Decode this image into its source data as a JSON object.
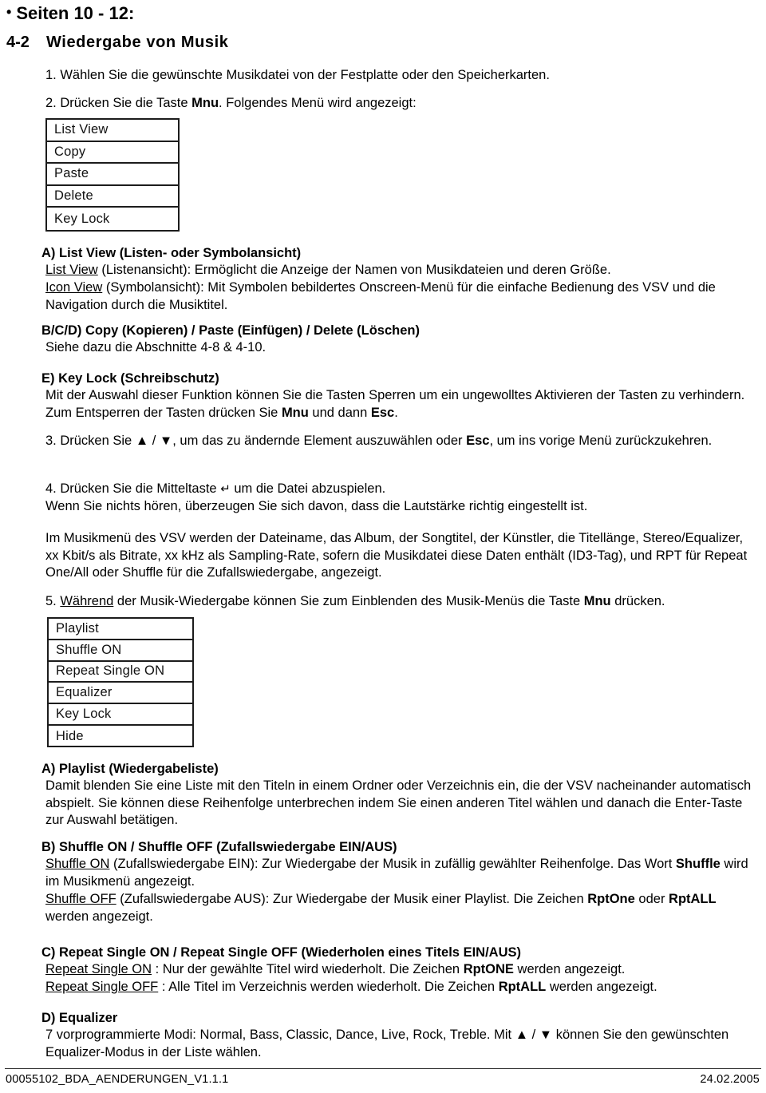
{
  "document": {
    "bullet_glyph": "•",
    "page_ref": "Seiten 10 - 12:",
    "section_number": "4-2",
    "section_title": "Wiedergabe von Musik"
  },
  "steps": {
    "step1": "1. Wählen Sie die gewünschte Musikdatei von der Festplatte oder den Speicherkarten.",
    "step2_a": "2. Drücken Sie die Taste ",
    "step2_key": "Mnu",
    "step2_b": ". Folgendes Menü wird angezeigt:",
    "step3_a": "3. Drücken Sie ",
    "step3_up": "▲",
    "step3_sep": " / ",
    "step3_down": "▼",
    "step3_b": ", um das zu ändernde Element auszuwählen oder ",
    "step3_key": "Esc",
    "step3_c": ", um ins vorige Menü zurückzukehren.",
    "step4_a": "4. Drücken Sie die Mitteltaste ",
    "step4_enter_glyph": "↵",
    "step4_b": "  um die Datei abzuspielen.",
    "step4_line2": "Wenn Sie nichts hören, überzeugen Sie sich davon, dass die Lautstärke richtig eingestellt ist.",
    "paragraph_id3": "Im Musikmenü des VSV werden der Dateiname, das Album, der Songtitel, der Künstler, die Titellänge, Stereo/Equalizer, xx Kbit/s als Bitrate, xx kHz als Sampling-Rate, sofern die Musikdatei diese Daten enthält (ID3-Tag), und RPT für Repeat One/All oder Shuffle für die Zufallswiedergabe, angezeigt.",
    "step5_num": "5. ",
    "step5_underlined": "Während",
    "step5_a": " der Musik-Wiedergabe können Sie zum Einblenden des Musik-Menüs die Taste ",
    "step5_key": "Mnu",
    "step5_b": " drücken."
  },
  "menu_box_1": {
    "items": [
      "List View",
      "Copy",
      "Paste",
      "Delete",
      "Key Lock"
    ]
  },
  "menu_box_2": {
    "items": [
      "Playlist",
      "Shuffle ON",
      "Repeat Single ON",
      "Equalizer",
      "Key Lock",
      "Hide"
    ]
  },
  "section_a_listview": {
    "heading": "A) List View (Listen- oder Symbolansicht)",
    "line1_underlined": "List View",
    "line1_rest": " (Listenansicht): Ermöglicht die Anzeige der Namen von Musikdateien und deren Größe.",
    "line2_underlined": "Icon View",
    "line2_rest": " (Symbolansicht): Mit Symbolen bebildertes Onscreen-Menü für die einfache Bedienung des VSV und die Navigation durch die Musiktitel."
  },
  "section_bcd_copy": {
    "heading": "B/C/D) Copy (Kopieren) / Paste (Einfügen) / Delete (Löschen)",
    "body": "Siehe dazu die Abschnitte 4-8 & 4-10."
  },
  "section_e_keylock": {
    "heading": "E) Key Lock (Schreibschutz)",
    "body_a": "Mit der Auswahl dieser Funktion können Sie die Tasten Sperren um ein ungewolltes Aktivieren der Tasten zu verhindern. Zum Entsperren der Tasten drücken Sie ",
    "key1": "Mnu",
    "body_b": " und dann ",
    "key2": "Esc",
    "body_c": "."
  },
  "section_a_playlist": {
    "heading": "A) Playlist (Wiedergabeliste)",
    "body": "Damit blenden Sie eine Liste mit den Titeln in einem Ordner oder Verzeichnis ein, die der VSV nacheinander automatisch abspielt. Sie können diese Reihenfolge unterbrechen indem Sie einen anderen Titel wählen und danach die Enter-Taste zur Auswahl betätigen."
  },
  "section_b_shuffle": {
    "heading": "B) Shuffle ON / Shuffle OFF (Zufallswiedergabe EIN/AUS)",
    "on_underlined": "Shuffle ON",
    "on_rest_a": " (Zufallswiedergabe EIN): Zur Wiedergabe der Musik in zufällig gewählter Reihenfolge. Das Wort ",
    "on_bold": "Shuffle",
    "on_rest_b": " wird im Musikmenü angezeigt.",
    "off_underlined": "Shuffle OFF",
    "off_rest_a": " (Zufallswiedergabe AUS): Zur Wiedergabe der Musik einer Playlist. Die Zeichen ",
    "off_bold1": "RptOne",
    "off_rest_b": " oder ",
    "off_bold2": "RptALL",
    "off_rest_c": " werden angezeigt."
  },
  "section_c_repeat": {
    "heading": "C) Repeat Single ON / Repeat Single OFF (Wiederholen eines Titels EIN/AUS)",
    "on_underlined": "Repeat Single ON",
    "on_rest_a": " : Nur der gewählte Titel wird wiederholt. Die Zeichen ",
    "on_bold": "RptONE",
    "on_rest_b": " werden angezeigt.",
    "off_underlined": "Repeat Single OFF",
    "off_rest_a": " : Alle Titel im Verzeichnis werden wiederholt. Die Zeichen ",
    "off_bold": "RptALL",
    "off_rest_b": " werden angezeigt."
  },
  "section_d_equalizer": {
    "heading": "D) Equalizer",
    "body_a": "7 vorprogrammierte Modi: Normal, Bass, Classic, Dance, Live, Rock, Treble. Mit ",
    "up": "▲",
    "sep": " / ",
    "down": "▼",
    "body_b": " können Sie den gewünschten Equalizer-Modus in der Liste wählen."
  },
  "footer": {
    "left": "00055102_BDA_AENDERUNGEN_V1.1.1",
    "right": "24.02.2005"
  }
}
